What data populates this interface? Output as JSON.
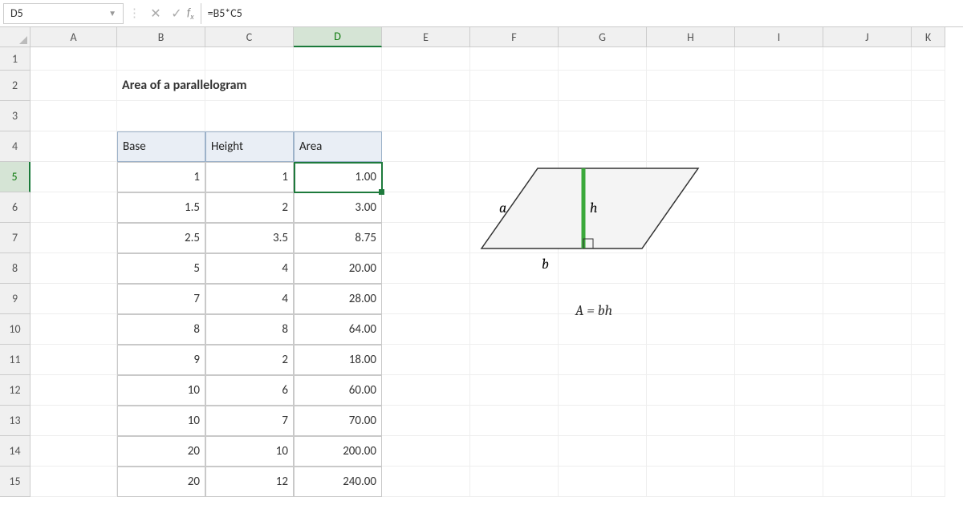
{
  "namebox": "D5",
  "formula": "=B5*C5",
  "title": "Area of a parallelogram",
  "columns": [
    "A",
    "B",
    "C",
    "D",
    "E",
    "F",
    "G",
    "H",
    "I",
    "J",
    "K"
  ],
  "rows": [
    "1",
    "2",
    "3",
    "4",
    "5",
    "6",
    "7",
    "8",
    "9",
    "10",
    "11",
    "12",
    "13",
    "14",
    "15"
  ],
  "selectedCol": "D",
  "selectedRow": "5",
  "table": {
    "headers": {
      "base": "Base",
      "height": "Height",
      "area": "Area"
    },
    "data": [
      {
        "base": "1",
        "height": "1",
        "area": "1.00"
      },
      {
        "base": "1.5",
        "height": "2",
        "area": "3.00"
      },
      {
        "base": "2.5",
        "height": "3.5",
        "area": "8.75"
      },
      {
        "base": "5",
        "height": "4",
        "area": "20.00"
      },
      {
        "base": "7",
        "height": "4",
        "area": "28.00"
      },
      {
        "base": "8",
        "height": "8",
        "area": "64.00"
      },
      {
        "base": "9",
        "height": "2",
        "area": "18.00"
      },
      {
        "base": "10",
        "height": "6",
        "area": "60.00"
      },
      {
        "base": "10",
        "height": "7",
        "area": "70.00"
      },
      {
        "base": "20",
        "height": "10",
        "area": "200.00"
      },
      {
        "base": "20",
        "height": "12",
        "area": "240.00"
      }
    ]
  },
  "diagram": {
    "a": "a",
    "b": "b",
    "h": "h",
    "formula": "A = bh"
  }
}
